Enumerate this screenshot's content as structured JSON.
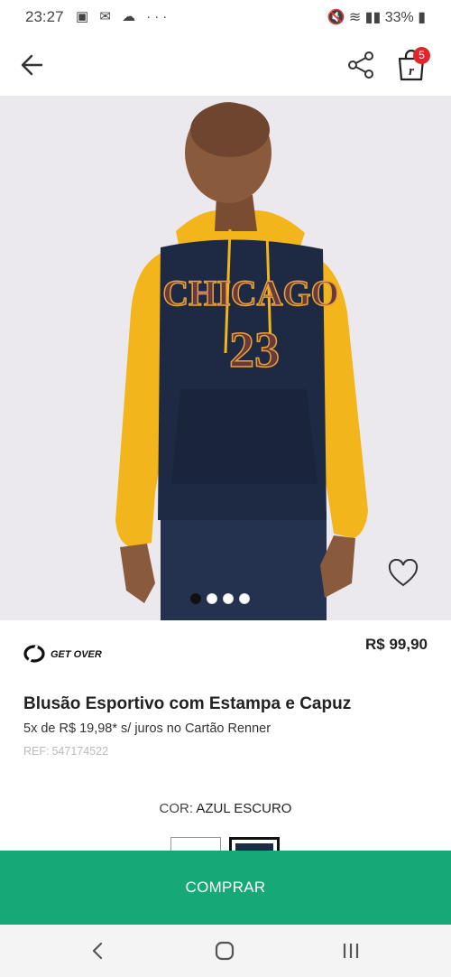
{
  "status": {
    "time": "23:27",
    "notifications": "▣ ✉ ☁ ···",
    "right": "🔇 ≋ ▮▮ 33% ▮"
  },
  "appbar": {
    "back_icon": "back-arrow-icon",
    "share_icon": "share-icon",
    "cart_icon": "cart-bag-icon",
    "cart_count": "5"
  },
  "gallery": {
    "dots": 4,
    "active_index": 0,
    "print_text": "CHICAGO",
    "print_number": "23"
  },
  "product": {
    "brand": "GET OVER",
    "price": "R$ 99,90",
    "title": "Blusão Esportivo com Estampa e Capuz",
    "installments": "5x de R$ 19,98* s/ juros no Cartão Renner",
    "ref_label": "REF:",
    "ref_value": "547174522",
    "color_label": "COR:",
    "color_value": "AZUL ESCURO"
  },
  "buy_button": "COMPRAR",
  "colors": {
    "accent": "#17a877",
    "badge": "#e0262c",
    "sweatshirt_body": "#1e2a44",
    "sweatshirt_sleeves": "#f2b51c"
  }
}
